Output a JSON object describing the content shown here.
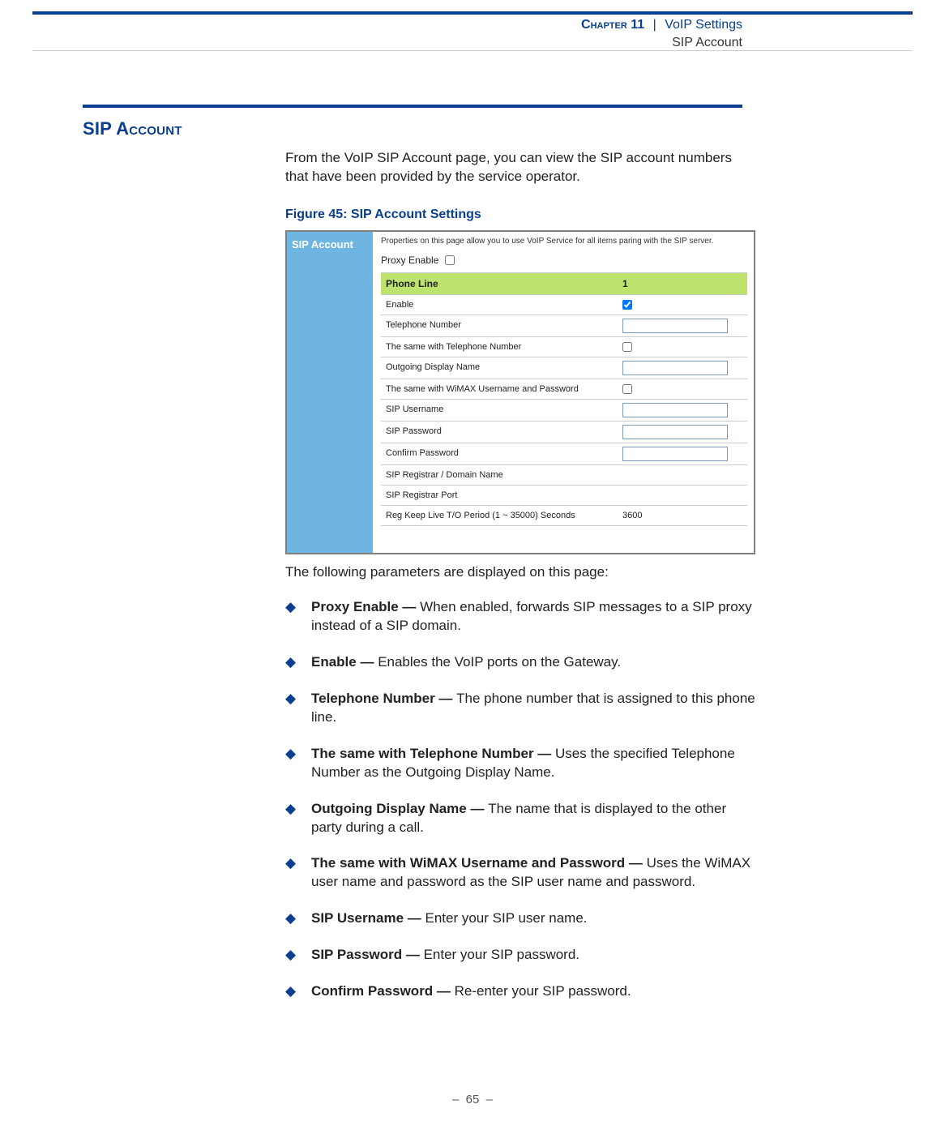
{
  "header": {
    "chapter": "Chapter 11",
    "sep": "|",
    "voip": "VoIP Settings",
    "sub": "SIP Account"
  },
  "section_title": "SIP Account",
  "intro": "From the VoIP SIP Account page, you can view the SIP account numbers that have been provided by the service operator.",
  "figure_caption": "Figure 45:  SIP Account Settings",
  "screenshot": {
    "side_title": "SIP Account",
    "desc": "Properties on this page allow you to use VoIP Service for all items paring with the SIP server.",
    "proxy_label": "Proxy Enable",
    "rows": [
      {
        "type": "head",
        "l": "Phone Line",
        "r": "1"
      },
      {
        "type": "chk",
        "l": "Enable",
        "checked": true
      },
      {
        "type": "input",
        "l": "Telephone Number",
        "val": ""
      },
      {
        "type": "chk",
        "l": "The same with Telephone Number",
        "checked": false
      },
      {
        "type": "input",
        "l": "Outgoing Display Name",
        "val": ""
      },
      {
        "type": "chk",
        "l": "The same with WiMAX Username and Password",
        "checked": false
      },
      {
        "type": "input",
        "l": "SIP Username",
        "val": ""
      },
      {
        "type": "input",
        "l": "SIP Password",
        "val": ""
      },
      {
        "type": "input",
        "l": "Confirm Password",
        "val": ""
      },
      {
        "type": "plain",
        "l": "SIP Registrar / Domain Name",
        "r": ""
      },
      {
        "type": "plain",
        "l": "SIP Registrar Port",
        "r": ""
      },
      {
        "type": "plain",
        "l": "Reg Keep Live T/O Period (1 ~ 35000) Seconds",
        "r": "3600"
      }
    ]
  },
  "params_intro": "The following parameters are displayed on this page:",
  "bullets": [
    {
      "term": "Proxy Enable — ",
      "desc": "When enabled, forwards SIP messages to a SIP proxy instead of a SIP domain."
    },
    {
      "term": "Enable — ",
      "desc": "Enables the VoIP ports on the Gateway."
    },
    {
      "term": "Telephone Number — ",
      "desc": "The phone number that is assigned to this phone line."
    },
    {
      "term": "The same with Telephone Number — ",
      "desc": "Uses the specified Telephone Number as the Outgoing Display Name."
    },
    {
      "term": "Outgoing Display Name — ",
      "desc": "The name that is displayed to the other party during a call."
    },
    {
      "term": "The same with WiMAX Username and Password — ",
      "desc": "Uses the WiMAX user name and password as the SIP user name and password."
    },
    {
      "term": "SIP Username — ",
      "desc": "Enter your SIP user name."
    },
    {
      "term": "SIP Password — ",
      "desc": "Enter your SIP password."
    },
    {
      "term": "Confirm Password — ",
      "desc": "Re-enter your SIP password."
    }
  ],
  "footer": "–  65  –"
}
